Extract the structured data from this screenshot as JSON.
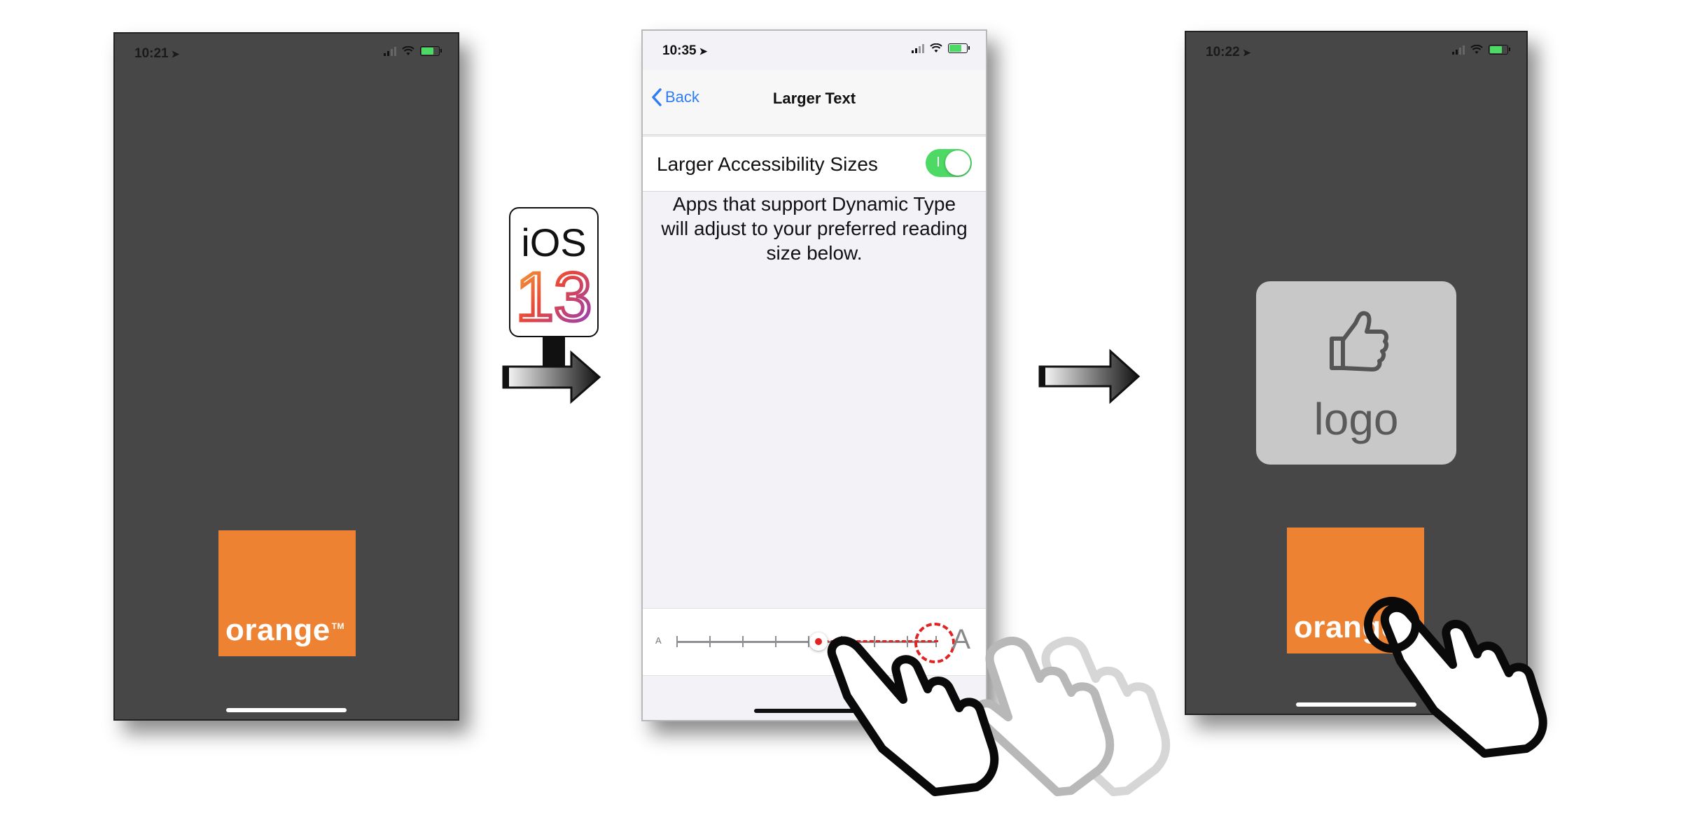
{
  "phone1": {
    "time": "10:21",
    "brand": "orange",
    "trademark": "TM"
  },
  "ios_badge": {
    "line1": "iOS",
    "line2": "13"
  },
  "phone2": {
    "time": "10:35",
    "back_label": "Back",
    "title": "Larger Text",
    "toggle_label": "Larger Accessibility Sizes",
    "toggle_on": true,
    "description": "Apps that support Dynamic Type will adjust to your preferred reading size below.",
    "slider_small_label": "A",
    "slider_large_label": "A",
    "slider_current_step": 5,
    "slider_target_step": 9
  },
  "phone3": {
    "time": "10:22",
    "logo_label": "logo",
    "brand": "orange",
    "trademark": "TM"
  },
  "colors": {
    "orange": "#ee8233",
    "dark_bg": "#474747",
    "ios_blue": "#2f7cf6",
    "switch_green": "#4cd964",
    "annotation_red": "#e02424"
  },
  "icons": [
    "location-arrow-icon",
    "signal-icon",
    "wifi-icon",
    "battery-icon",
    "chevron-left-icon",
    "thumbs-up-icon",
    "hand-pointer-icon",
    "arrow-right-icon"
  ]
}
